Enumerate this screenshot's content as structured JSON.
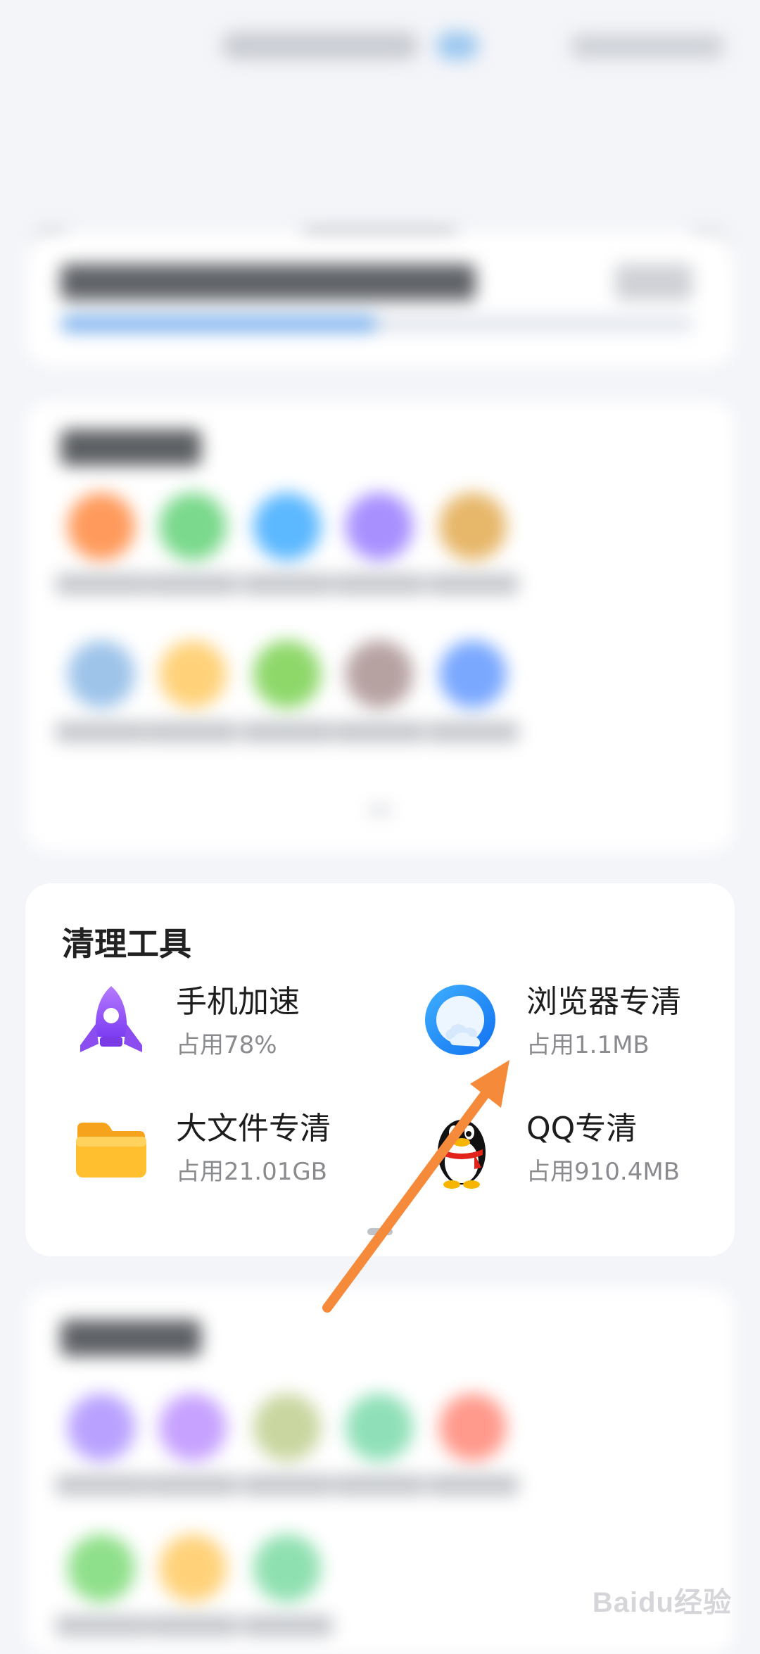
{
  "tools": {
    "title": "清理工具",
    "items": [
      {
        "name": "手机加速",
        "usage": "占用78%",
        "icon": "rocket-icon"
      },
      {
        "name": "浏览器专清",
        "usage": "占用1.1MB",
        "icon": "browser-icon"
      },
      {
        "name": "大文件专清",
        "usage": "占用21.01GB",
        "icon": "folder-icon"
      },
      {
        "name": "QQ专清",
        "usage": "占用910.4MB",
        "icon": "qq-penguin-icon"
      }
    ]
  },
  "watermark": "Baidu经验",
  "colors": {
    "accent_arrow": "#f58a3a",
    "storage_bar": "#7eb2ee"
  },
  "storage": {
    "fill_fraction": 0.5
  }
}
